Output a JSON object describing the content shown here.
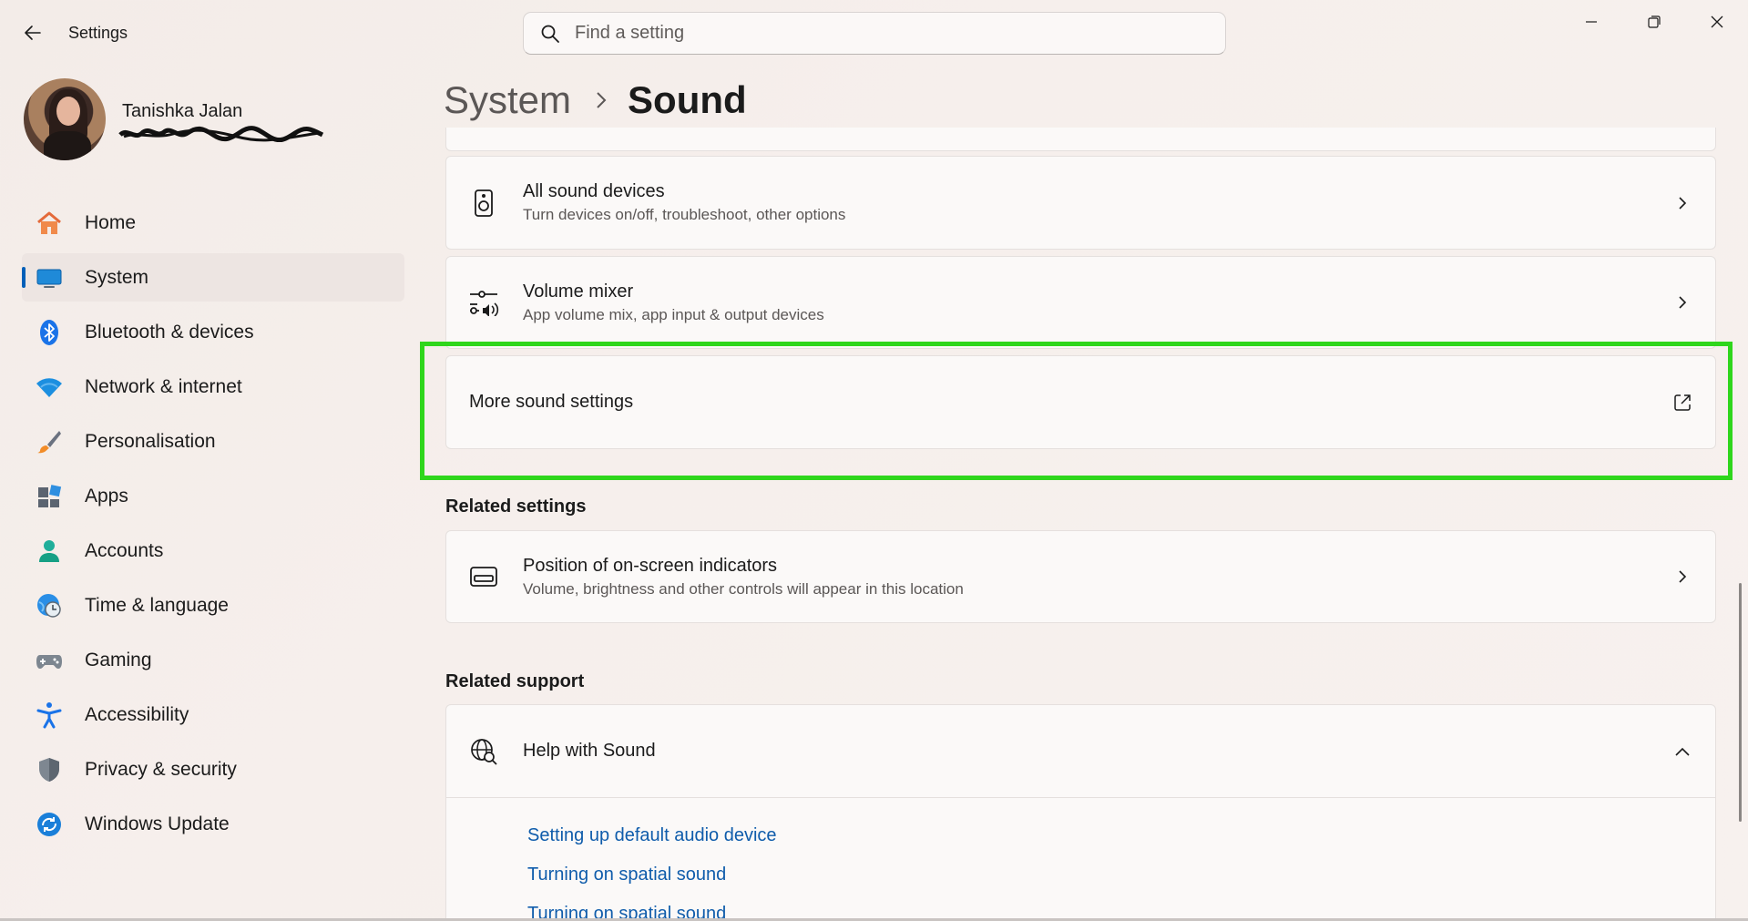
{
  "window": {
    "app_title": "Settings"
  },
  "search": {
    "placeholder": "Find a setting"
  },
  "profile": {
    "name": "Tanishka Jalan"
  },
  "sidebar": {
    "items": [
      {
        "label": "Home",
        "icon": "home-icon",
        "active": false
      },
      {
        "label": "System",
        "icon": "system-icon",
        "active": true
      },
      {
        "label": "Bluetooth & devices",
        "icon": "bluetooth-icon",
        "active": false
      },
      {
        "label": "Network & internet",
        "icon": "wifi-icon",
        "active": false
      },
      {
        "label": "Personalisation",
        "icon": "brush-icon",
        "active": false
      },
      {
        "label": "Apps",
        "icon": "apps-icon",
        "active": false
      },
      {
        "label": "Accounts",
        "icon": "accounts-icon",
        "active": false
      },
      {
        "label": "Time & language",
        "icon": "globe-clock-icon",
        "active": false
      },
      {
        "label": "Gaming",
        "icon": "gamepad-icon",
        "active": false
      },
      {
        "label": "Accessibility",
        "icon": "accessibility-icon",
        "active": false
      },
      {
        "label": "Privacy & security",
        "icon": "shield-icon",
        "active": false
      },
      {
        "label": "Windows Update",
        "icon": "update-icon",
        "active": false
      }
    ]
  },
  "breadcrumb": {
    "parent": "System",
    "current": "Sound"
  },
  "cards": {
    "all_devices": {
      "title": "All sound devices",
      "subtitle": "Turn devices on/off, troubleshoot, other options",
      "icon": "speaker-icon"
    },
    "volume_mixer": {
      "title": "Volume mixer",
      "subtitle": "App volume mix, app input & output devices",
      "icon": "mixer-icon"
    },
    "more_sound": {
      "title": "More sound settings",
      "icon": "external-link-icon"
    }
  },
  "related_settings": {
    "heading": "Related settings",
    "position": {
      "title": "Position of on-screen indicators",
      "subtitle": "Volume, brightness and other controls will appear in this location",
      "icon": "indicator-position-icon"
    }
  },
  "related_support": {
    "heading": "Related support",
    "help": {
      "title": "Help with Sound",
      "icon": "globe-search-icon",
      "links": [
        "Setting up default audio device",
        "Turning on spatial sound",
        "Turning on spatial sound"
      ]
    }
  },
  "colors": {
    "accent": "#005fb8",
    "link": "#0f5cab",
    "highlight": "#2fd61c"
  }
}
